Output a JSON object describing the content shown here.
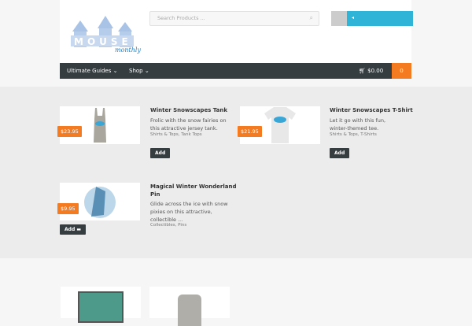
{
  "header": {
    "logo_text": "MOUSE monthly",
    "search_placeholder": "Search Products ...",
    "user_icon": "sign-in-icon"
  },
  "nav": {
    "items": [
      {
        "label": "Ultimate Guides ⌄"
      },
      {
        "label": "Shop ⌄"
      }
    ],
    "cart_total": "$0.00",
    "cart_count": "0"
  },
  "products": [
    {
      "title": "Winter Snowscapes Tank",
      "description": "Frolic with the snow fairies on this attractive jersey tank.",
      "categories": "Shirts & Tops, Tank Tops",
      "price": "$23.95",
      "button": "Add"
    },
    {
      "title": "Winter Snowscapes T-Shirt",
      "description": "Let it go with this fun, winter-themed tee.",
      "categories": "Shirts & Tops, T-Shirts",
      "price": "$21.95",
      "button": "Add"
    },
    {
      "title": "Magical Winter Wonderland Pin",
      "description": "Glide across the ice with snow pixies on this attractive, collectible ...",
      "categories": "Collectibles, Pins",
      "price": "$9.95",
      "button": "Add"
    }
  ],
  "colors": {
    "accent": "#f47b20",
    "nav": "#353d40",
    "user": "#2fb3d6"
  }
}
